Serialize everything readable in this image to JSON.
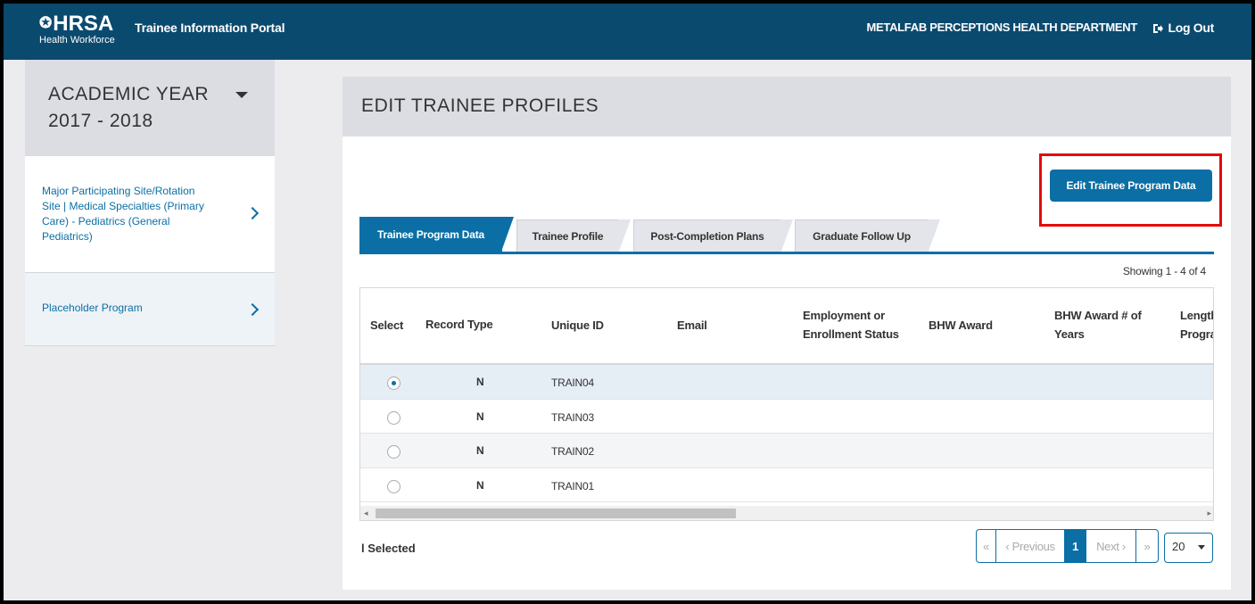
{
  "header": {
    "logo_text": "HRSA",
    "logo_subtext": "Health Workforce",
    "portal_title": "Trainee Information Portal",
    "organization": "METALFAB PERCEPTIONS HEALTH DEPARTMENT",
    "logout_label": "Log Out"
  },
  "sidebar": {
    "academic_year": "ACADEMIC YEAR 2017 - 2018",
    "items": [
      {
        "label": "Major Participating Site/Rotation Site | Medical Specialties (Primary Care) - Pediatrics (General Pediatrics)"
      },
      {
        "label": "Placeholder Program"
      }
    ]
  },
  "main": {
    "title": "EDIT TRAINEE PROFILES",
    "edit_button_label": "Edit Trainee Program Data",
    "tabs": [
      {
        "label": "Trainee Program Data",
        "active": true
      },
      {
        "label": "Trainee Profile",
        "active": false
      },
      {
        "label": "Post-Completion Plans",
        "active": false
      },
      {
        "label": "Graduate Follow Up",
        "active": false
      }
    ],
    "showing": "Showing 1 - 4 of 4",
    "table": {
      "columns": [
        "Select",
        "Record Type",
        "Unique ID",
        "Email",
        "Employment or Enrollment Status",
        "BHW Award",
        "BHW Award # of Years",
        "Length of Program"
      ],
      "rows": [
        {
          "record_type": "N",
          "unique_id": "TRAIN04",
          "selected": true
        },
        {
          "record_type": "N",
          "unique_id": "TRAIN03",
          "selected": false
        },
        {
          "record_type": "N",
          "unique_id": "TRAIN02",
          "selected": false
        },
        {
          "record_type": "N",
          "unique_id": "TRAIN01",
          "selected": false
        }
      ]
    },
    "selected_count": "l Selected",
    "pagination": {
      "first": "«",
      "previous": "‹ Previous",
      "current": "1",
      "next": "Next ›",
      "last": "»",
      "page_size": "20"
    }
  },
  "colors": {
    "header_bg": "#0b4a6f",
    "accent": "#0b6fa5",
    "highlight": "#e30b0b"
  }
}
